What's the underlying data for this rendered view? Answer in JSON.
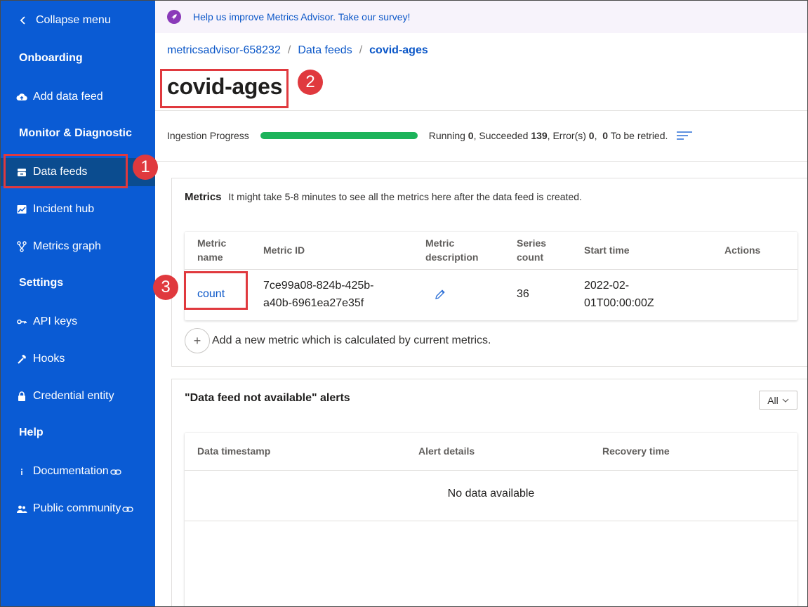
{
  "sidebar": {
    "collapse_label": "Collapse menu",
    "sections": {
      "onboarding": "Onboarding",
      "monitor": "Monitor & Diagnostic",
      "settings": "Settings",
      "help": "Help"
    },
    "items": {
      "add_data_feed": "Add data feed",
      "data_feeds": "Data feeds",
      "incident_hub": "Incident hub",
      "metrics_graph": "Metrics graph",
      "api_keys": "API keys",
      "hooks": "Hooks",
      "credential_entity": "Credential entity",
      "documentation": "Documentation",
      "public_community": "Public community"
    },
    "active_item": "Data feeds"
  },
  "banner": {
    "text": "Help us improve Metrics Advisor. Take our survey!"
  },
  "breadcrumb": {
    "root": "metricsadvisor-658232",
    "parent": "Data feeds",
    "current": "covid-ages"
  },
  "page_title": "covid-ages",
  "ingestion": {
    "label": "Ingestion Progress",
    "progress_percent": 100,
    "running_label": "Running",
    "running": "0",
    "succeeded_label": "Succeeded",
    "succeeded": "139",
    "errors_label": "Error(s)",
    "errors": "0",
    "retry_count": "0",
    "retry_label": "To be retried."
  },
  "metrics": {
    "heading": "Metrics",
    "note": "It might take 5-8 minutes to see all the metrics here after the data feed is created.",
    "columns": {
      "name_l1": "Metric",
      "name_l2": "name",
      "id": "Metric ID",
      "desc_l1": "Metric",
      "desc_l2": "description",
      "series_l1": "Series",
      "series_l2": "count",
      "start": "Start time",
      "actions": "Actions"
    },
    "rows": [
      {
        "name": "count",
        "id_l1": "7ce99a08-824b-425b-",
        "id_l2": "a40b-6961ea27e35f",
        "series_count": "36",
        "start_l1": "2022-02-",
        "start_l2": "01T00:00:00Z"
      }
    ],
    "add_label": "Add a new metric which is calculated by current metrics."
  },
  "alerts": {
    "heading": "\"Data feed not available\" alerts",
    "filter_value": "All",
    "columns": {
      "timestamp": "Data timestamp",
      "details": "Alert details",
      "recovery": "Recovery time"
    },
    "empty": "No data available"
  },
  "annotations": {
    "one": "1",
    "two": "2",
    "three": "3"
  },
  "colors": {
    "sidebar": "#0a5bd4",
    "accent": "#e0393e",
    "link": "#0b57c8",
    "progress": "#1cb35a"
  }
}
